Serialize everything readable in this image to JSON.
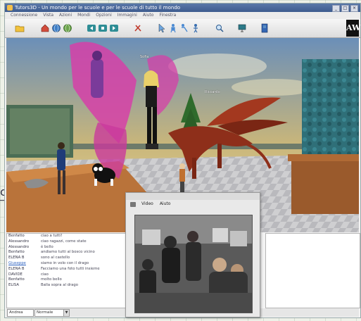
{
  "window": {
    "title": "Tutors3D - Un mondo per le scuole e per le scuole di tutto il mondo"
  },
  "menubar": [
    "Connessione",
    "Vista",
    "Azioni",
    "Mondi",
    "Opzioni",
    "Immagini",
    "Aiuto",
    "Finestra"
  ],
  "toolbar": {
    "icons": [
      "folder-icon",
      "home-icon",
      "globe-icon",
      "globe-icon",
      "back-icon",
      "stop-icon",
      "forward-icon",
      "tools-icon",
      "cursor-icon",
      "sit-icon",
      "fly-icon",
      "search-icon",
      "monitor-icon",
      "book-icon"
    ],
    "logo": "AW"
  },
  "scene": {
    "name_tags": [
      "Sofia",
      "Riccardo"
    ]
  },
  "chat": {
    "rows": [
      {
        "who": "Benfatto",
        "msg": "ciao a tutti!",
        "link": false
      },
      {
        "who": "Alessandro",
        "msg": "ciao ragazzi, come state",
        "link": false
      },
      {
        "who": "Alessandro",
        "msg": "è bello",
        "link": false
      },
      {
        "who": "Benfatto",
        "msg": "andiamo tutti al bosco vicino",
        "link": false
      },
      {
        "who": "ELENA B",
        "msg": "sono al castello",
        "link": false
      },
      {
        "who": "Giuseppe",
        "msg": "siamo in volo con il drago",
        "link": true
      },
      {
        "who": "ELENA B",
        "msg": "Facciamo una foto tutti insieme",
        "link": false
      },
      {
        "who": "DAVIDE",
        "msg": "ciao",
        "link": false
      },
      {
        "who": "Benfatto",
        "msg": "molto bello",
        "link": false
      },
      {
        "who": "ELISA",
        "msg": "Balla sopra al drago",
        "link": false
      }
    ]
  },
  "input_bar": {
    "chat_value": "Andrea",
    "mode": "Normale"
  },
  "webcam": {
    "menu": [
      "Video",
      "Aiuto"
    ]
  },
  "colors": {
    "titlebar": "#3d5b8f",
    "link": "#2a5fbf",
    "wing": "#d63fa8"
  }
}
